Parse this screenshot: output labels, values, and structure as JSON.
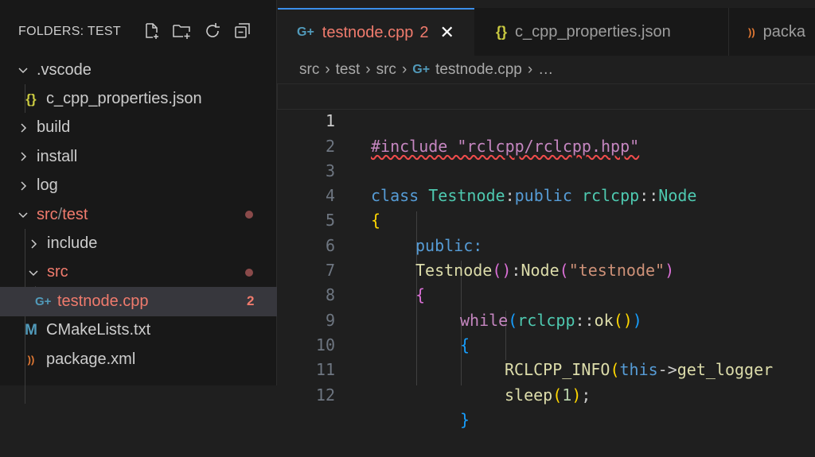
{
  "sidebar": {
    "title": "FOLDERS: TEST",
    "actions": [
      "new-file-icon",
      "new-folder-icon",
      "refresh-icon",
      "collapse-all-icon"
    ],
    "tree": [
      {
        "label": ".vscode",
        "kind": "folder",
        "expanded": true,
        "depth": 0
      },
      {
        "label": "c_cpp_properties.json",
        "kind": "json",
        "depth": 1,
        "icon": "{}"
      },
      {
        "label": "build",
        "kind": "folder",
        "expanded": false,
        "depth": 0
      },
      {
        "label": "install",
        "kind": "folder",
        "expanded": false,
        "depth": 0
      },
      {
        "label": "log",
        "kind": "folder",
        "expanded": false,
        "depth": 0
      },
      {
        "label": "src",
        "label2": "/",
        "label3": "test",
        "kind": "folder",
        "expanded": true,
        "depth": 0,
        "modified": true
      },
      {
        "label": "include",
        "kind": "folder",
        "expanded": false,
        "depth": 1
      },
      {
        "label": "src",
        "kind": "folder",
        "expanded": true,
        "depth": 1,
        "modified": true
      },
      {
        "label": "testnode.cpp",
        "kind": "cpp",
        "depth": 2,
        "badge": "2",
        "selected": true,
        "icon": "G+"
      },
      {
        "label": "CMakeLists.txt",
        "kind": "cmake",
        "depth": 1,
        "icon": "M"
      },
      {
        "label": "package.xml",
        "kind": "xml",
        "depth": 1,
        "icon": "))"
      }
    ]
  },
  "tabs": [
    {
      "label": "testnode.cpp",
      "badge": "2",
      "active": true,
      "icon": "G+"
    },
    {
      "label": "c_cpp_properties.json",
      "active": false,
      "icon": "{}"
    },
    {
      "label": "packa",
      "active": false,
      "icon": "))"
    }
  ],
  "breadcrumb": [
    "src",
    "test",
    "src",
    "testnode.cpp",
    "…"
  ],
  "code": {
    "line_numbers": [
      "1",
      "2",
      "3",
      "4",
      "5",
      "6",
      "7",
      "8",
      "9",
      "10",
      "11",
      "12"
    ],
    "line1": "#include \"rclcpp/rclcpp.hpp\"",
    "l3_class": "class",
    "l3_name": "Testnode",
    "l3_colon": ":",
    "l3_public": "public",
    "l3_ns": "rclcpp",
    "l3_sep": "::",
    "l3_node": "Node",
    "l4": "{",
    "l5": "public:",
    "l6_fn": "Testnode",
    "l6_p": "()",
    "l6_colon": ":",
    "l6_node": "Node",
    "l6_po": "(",
    "l6_str": "\"testnode\"",
    "l6_pc": ")",
    "l7": "{",
    "l8_while": "while",
    "l8_po": "(",
    "l8_ns": "rclcpp",
    "l8_sep": "::",
    "l8_fn": "ok",
    "l8_inner": "()",
    "l8_pc": ")",
    "l9": "{",
    "l10_fn": "RCLCPP_INFO",
    "l10_po": "(",
    "l10_this": "this",
    "l10_arrow": "->",
    "l10_rest": "get_logger",
    "l11_fn": "sleep",
    "l11_po": "(",
    "l11_num": "1",
    "l11_pc": ")",
    "l11_semi": ";",
    "l12": "}"
  },
  "colors": {
    "accent": "#3b8eea",
    "modified": "#f07b6d",
    "sidebar_bg": "#181818",
    "editor_bg": "#1f1f1f"
  }
}
